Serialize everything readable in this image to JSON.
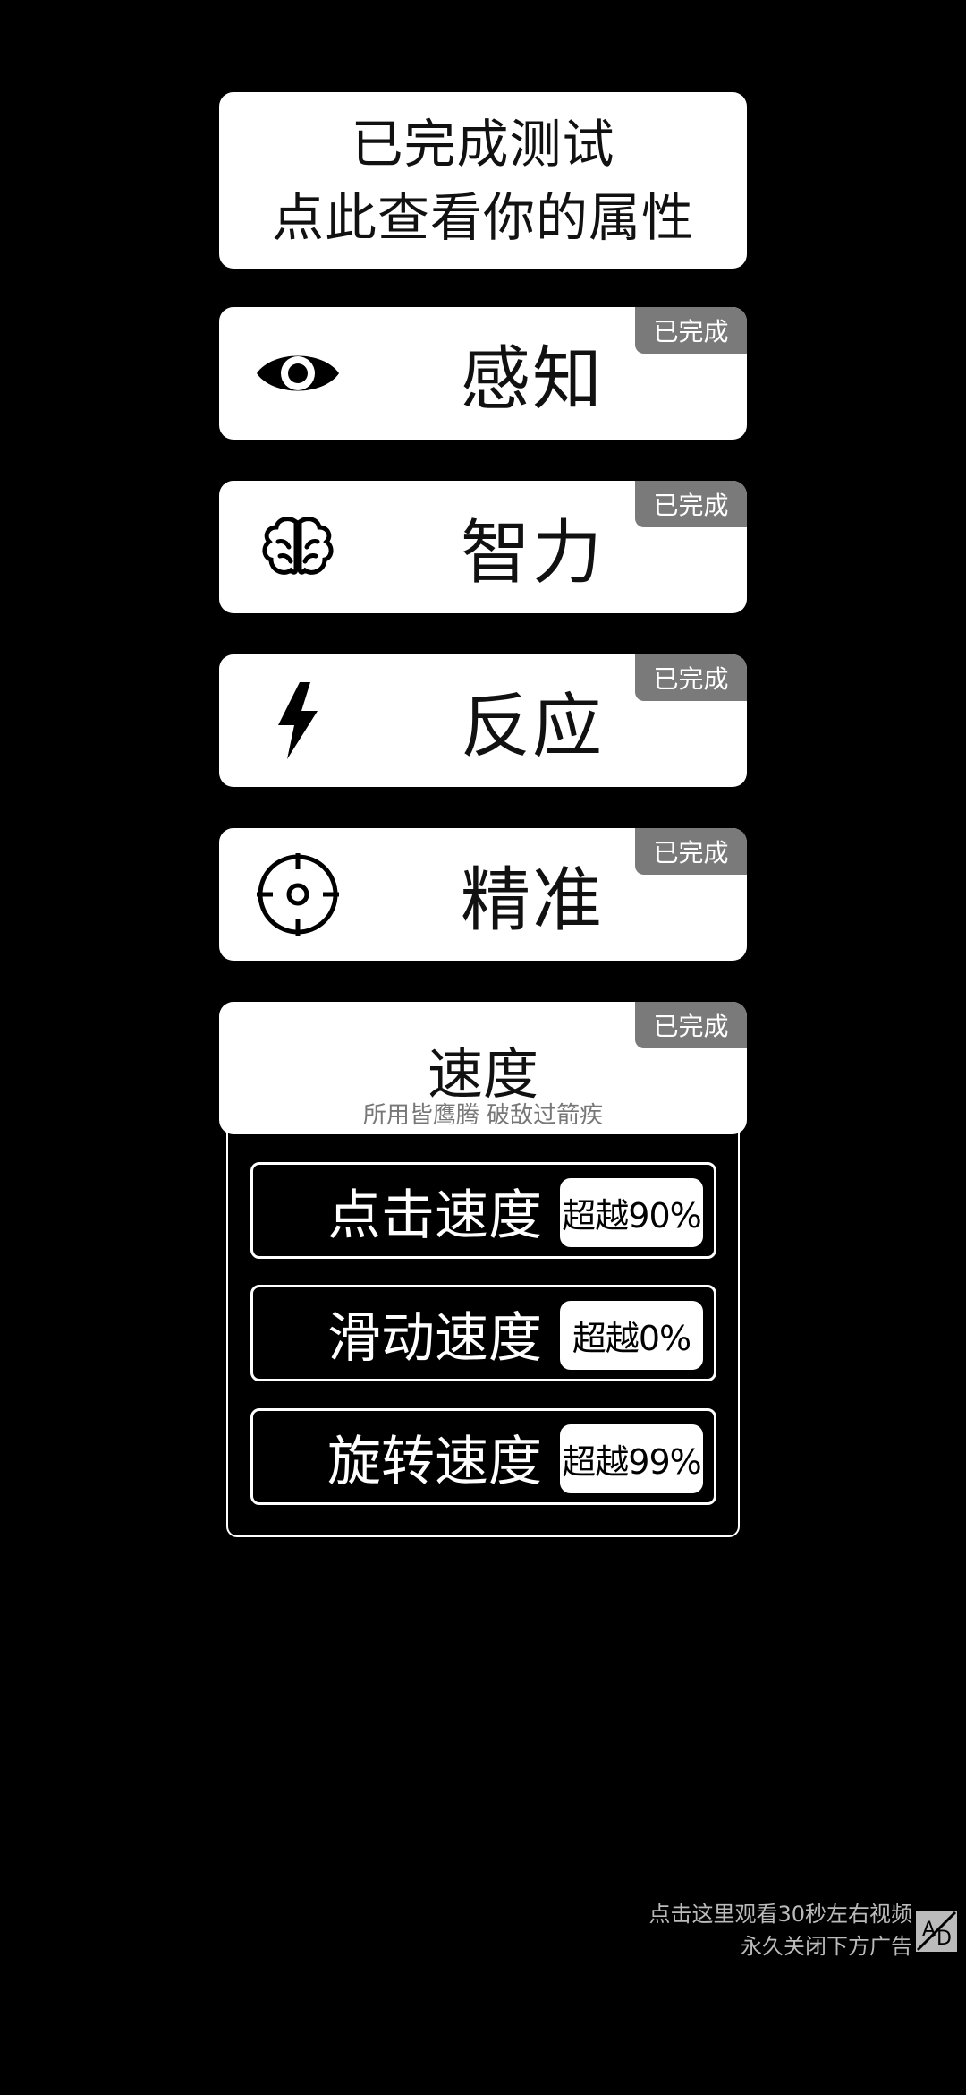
{
  "header": {
    "line1": "已完成测试",
    "line2": "点此查看你的属性"
  },
  "attributes": [
    {
      "label": "感知",
      "badge": "已完成",
      "icon": "eye-icon"
    },
    {
      "label": "智力",
      "badge": "已完成",
      "icon": "brain-icon"
    },
    {
      "label": "反应",
      "badge": "已完成",
      "icon": "lightning-icon"
    },
    {
      "label": "精准",
      "badge": "已完成",
      "icon": "crosshair-icon"
    }
  ],
  "speed": {
    "title": "速度",
    "subtitle": "所用皆鹰腾 破敌过箭疾",
    "badge": "已完成",
    "rows": [
      {
        "label": "点击速度",
        "value": "超越90%"
      },
      {
        "label": "滑动速度",
        "value": "超越0%"
      },
      {
        "label": "旋转速度",
        "value": "超越99%"
      }
    ]
  },
  "ad": {
    "line1": "点击这里观看30秒左右视频",
    "line2": "永久关闭下方广告",
    "icon": "ad-icon"
  }
}
